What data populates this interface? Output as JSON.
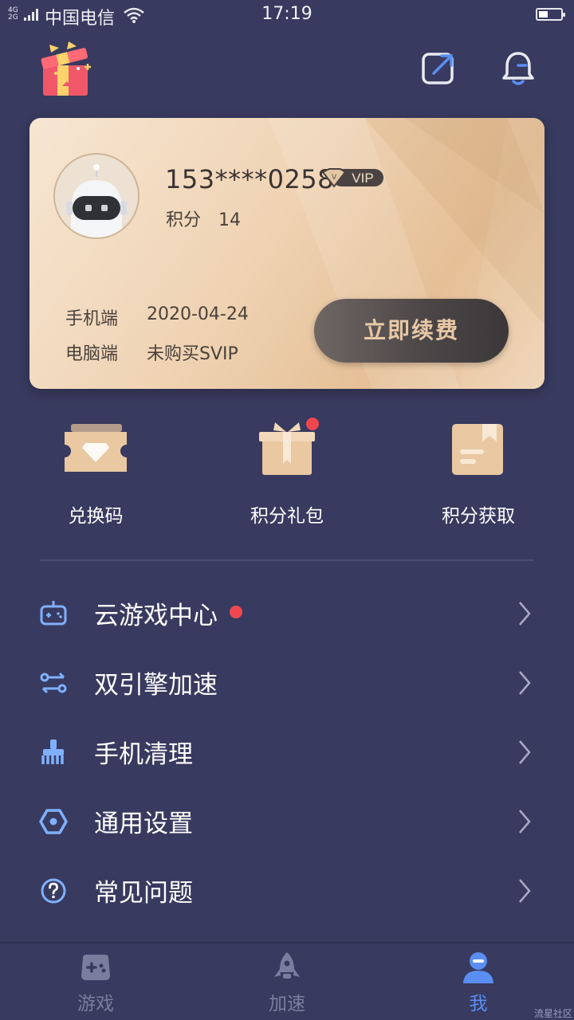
{
  "status_bar": {
    "network_top": "4G",
    "network_bottom": "2G",
    "carrier": "中国电信",
    "time": "17:19",
    "battery_level": 0.35
  },
  "header": {
    "left_icon": "gift-box-icon",
    "edit_icon": "edit-external-icon",
    "bell_icon": "bell-icon"
  },
  "vip_card": {
    "phone": "153****0258",
    "vip_badge": "VIP",
    "points_label": "积分",
    "points_value": "14",
    "mobile_label": "手机端",
    "mobile_value": "2020-04-24",
    "pc_label": "电脑端",
    "pc_value": "未购买SVIP",
    "renew_label": "立即续费"
  },
  "quick_actions": [
    {
      "label": "兑换码",
      "icon": "ticket-diamond-icon",
      "has_dot": false
    },
    {
      "label": "积分礼包",
      "icon": "gift-box-icon",
      "has_dot": true
    },
    {
      "label": "积分获取",
      "icon": "bookmark-doc-icon",
      "has_dot": false
    }
  ],
  "menu": [
    {
      "label": "云游戏中心",
      "icon": "gamepad-icon",
      "has_dot": true
    },
    {
      "label": "双引擎加速",
      "icon": "dual-engine-icon",
      "has_dot": false
    },
    {
      "label": "手机清理",
      "icon": "broom-icon",
      "has_dot": false
    },
    {
      "label": "通用设置",
      "icon": "settings-hexagon-icon",
      "has_dot": false
    },
    {
      "label": "常见问题",
      "icon": "question-icon",
      "has_dot": false
    }
  ],
  "tabs": [
    {
      "label": "游戏",
      "icon": "gamepad-icon",
      "active": false
    },
    {
      "label": "加速",
      "icon": "rocket-icon",
      "active": false
    },
    {
      "label": "我",
      "icon": "user-icon",
      "active": true
    }
  ],
  "watermark": "流星社区",
  "colors": {
    "background": "#383a5f",
    "accent": "#5b8ef2",
    "gold": "#e8c8a5",
    "badge_dot": "#f0474f"
  }
}
